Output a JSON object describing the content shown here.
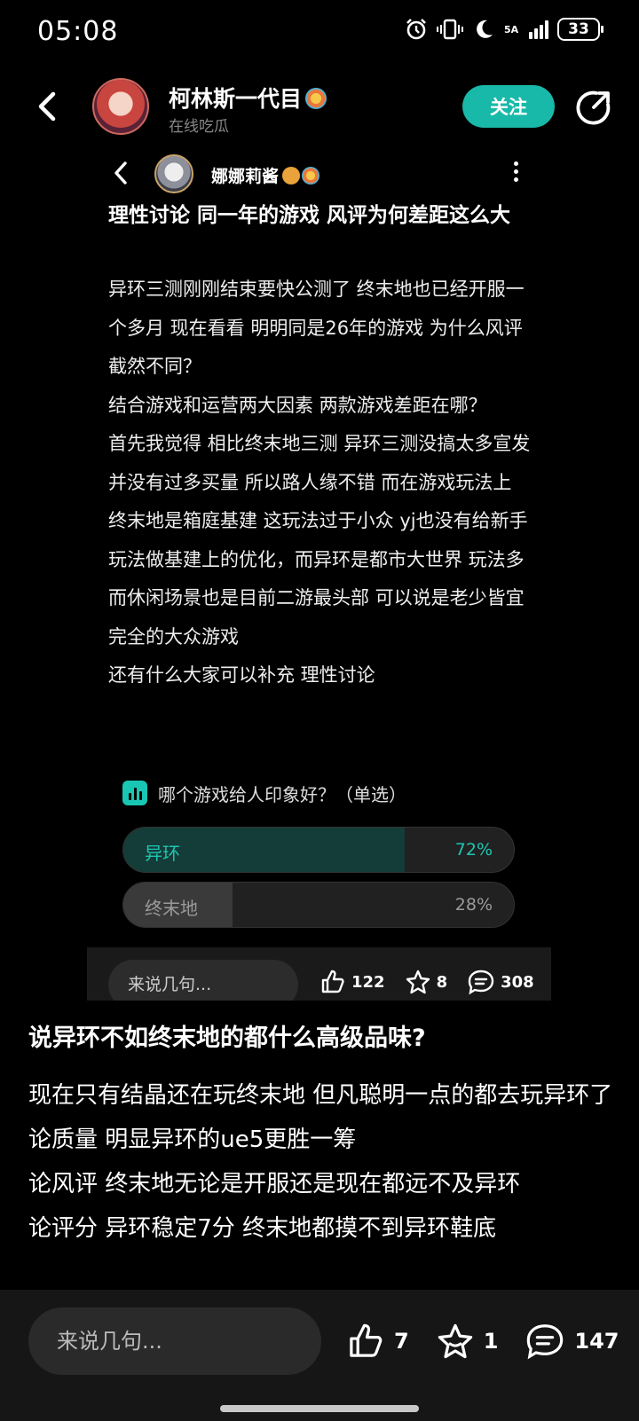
{
  "status": {
    "time": "05:08",
    "network": "5A",
    "battery": "33"
  },
  "header": {
    "author_name": "柯林斯一代目",
    "author_subtitle": "在线吃瓜",
    "follow_label": "关注"
  },
  "embed": {
    "author_name": "娜娜莉酱",
    "title": "理性讨论 同一年的游戏 风评为何差距这么大",
    "paragraphs": [
      "异环三测刚刚结束要快公测了 终末地也已经开服一个多月 现在看看 明明同是26年的游戏 为什么风评截然不同？",
      "结合游戏和运营两大因素 两款游戏差距在哪？",
      "首先我觉得 相比终末地三测 异环三测没搞太多宣发 并没有过多买量 所以路人缘不错 而在游戏玩法上 终末地是箱庭基建 这玩法过于小众 yj也没有给新手玩法做基建上的优化，而异环是都市大世界 玩法多而休闲场景也是目前二游最头部 可以说是老少皆宜 完全的大众游戏",
      "还有什么大家可以补充 理性讨论"
    ],
    "poll": {
      "question": "哪个游戏给人印象好？（单选）",
      "options": [
        {
          "label": "异环",
          "percent_label": "72%",
          "percent": 72,
          "fill_color": "#143c38",
          "text_color": "#1ec7b2"
        },
        {
          "label": "终末地",
          "percent_label": "28%",
          "percent": 28,
          "fill_color": "#3a3a3a",
          "text_color": "#9a9a9a"
        }
      ]
    },
    "comment_placeholder": "来说几句...",
    "likes": "122",
    "favorites": "8",
    "comments": "308"
  },
  "main": {
    "title": "说异环不如终末地的都什么高级品味?",
    "lines": [
      "现在只有结晶还在玩终末地 但凡聪明一点的都去玩异环了",
      "论质量 明显异环的ue5更胜一筹",
      "论风评 终末地无论是开服还是现在都远不及异环",
      "论评分 异环稳定7分 终末地都摸不到异环鞋底"
    ]
  },
  "bottom": {
    "comment_placeholder": "来说几句...",
    "likes": "7",
    "favorites": "1",
    "comments": "147"
  }
}
